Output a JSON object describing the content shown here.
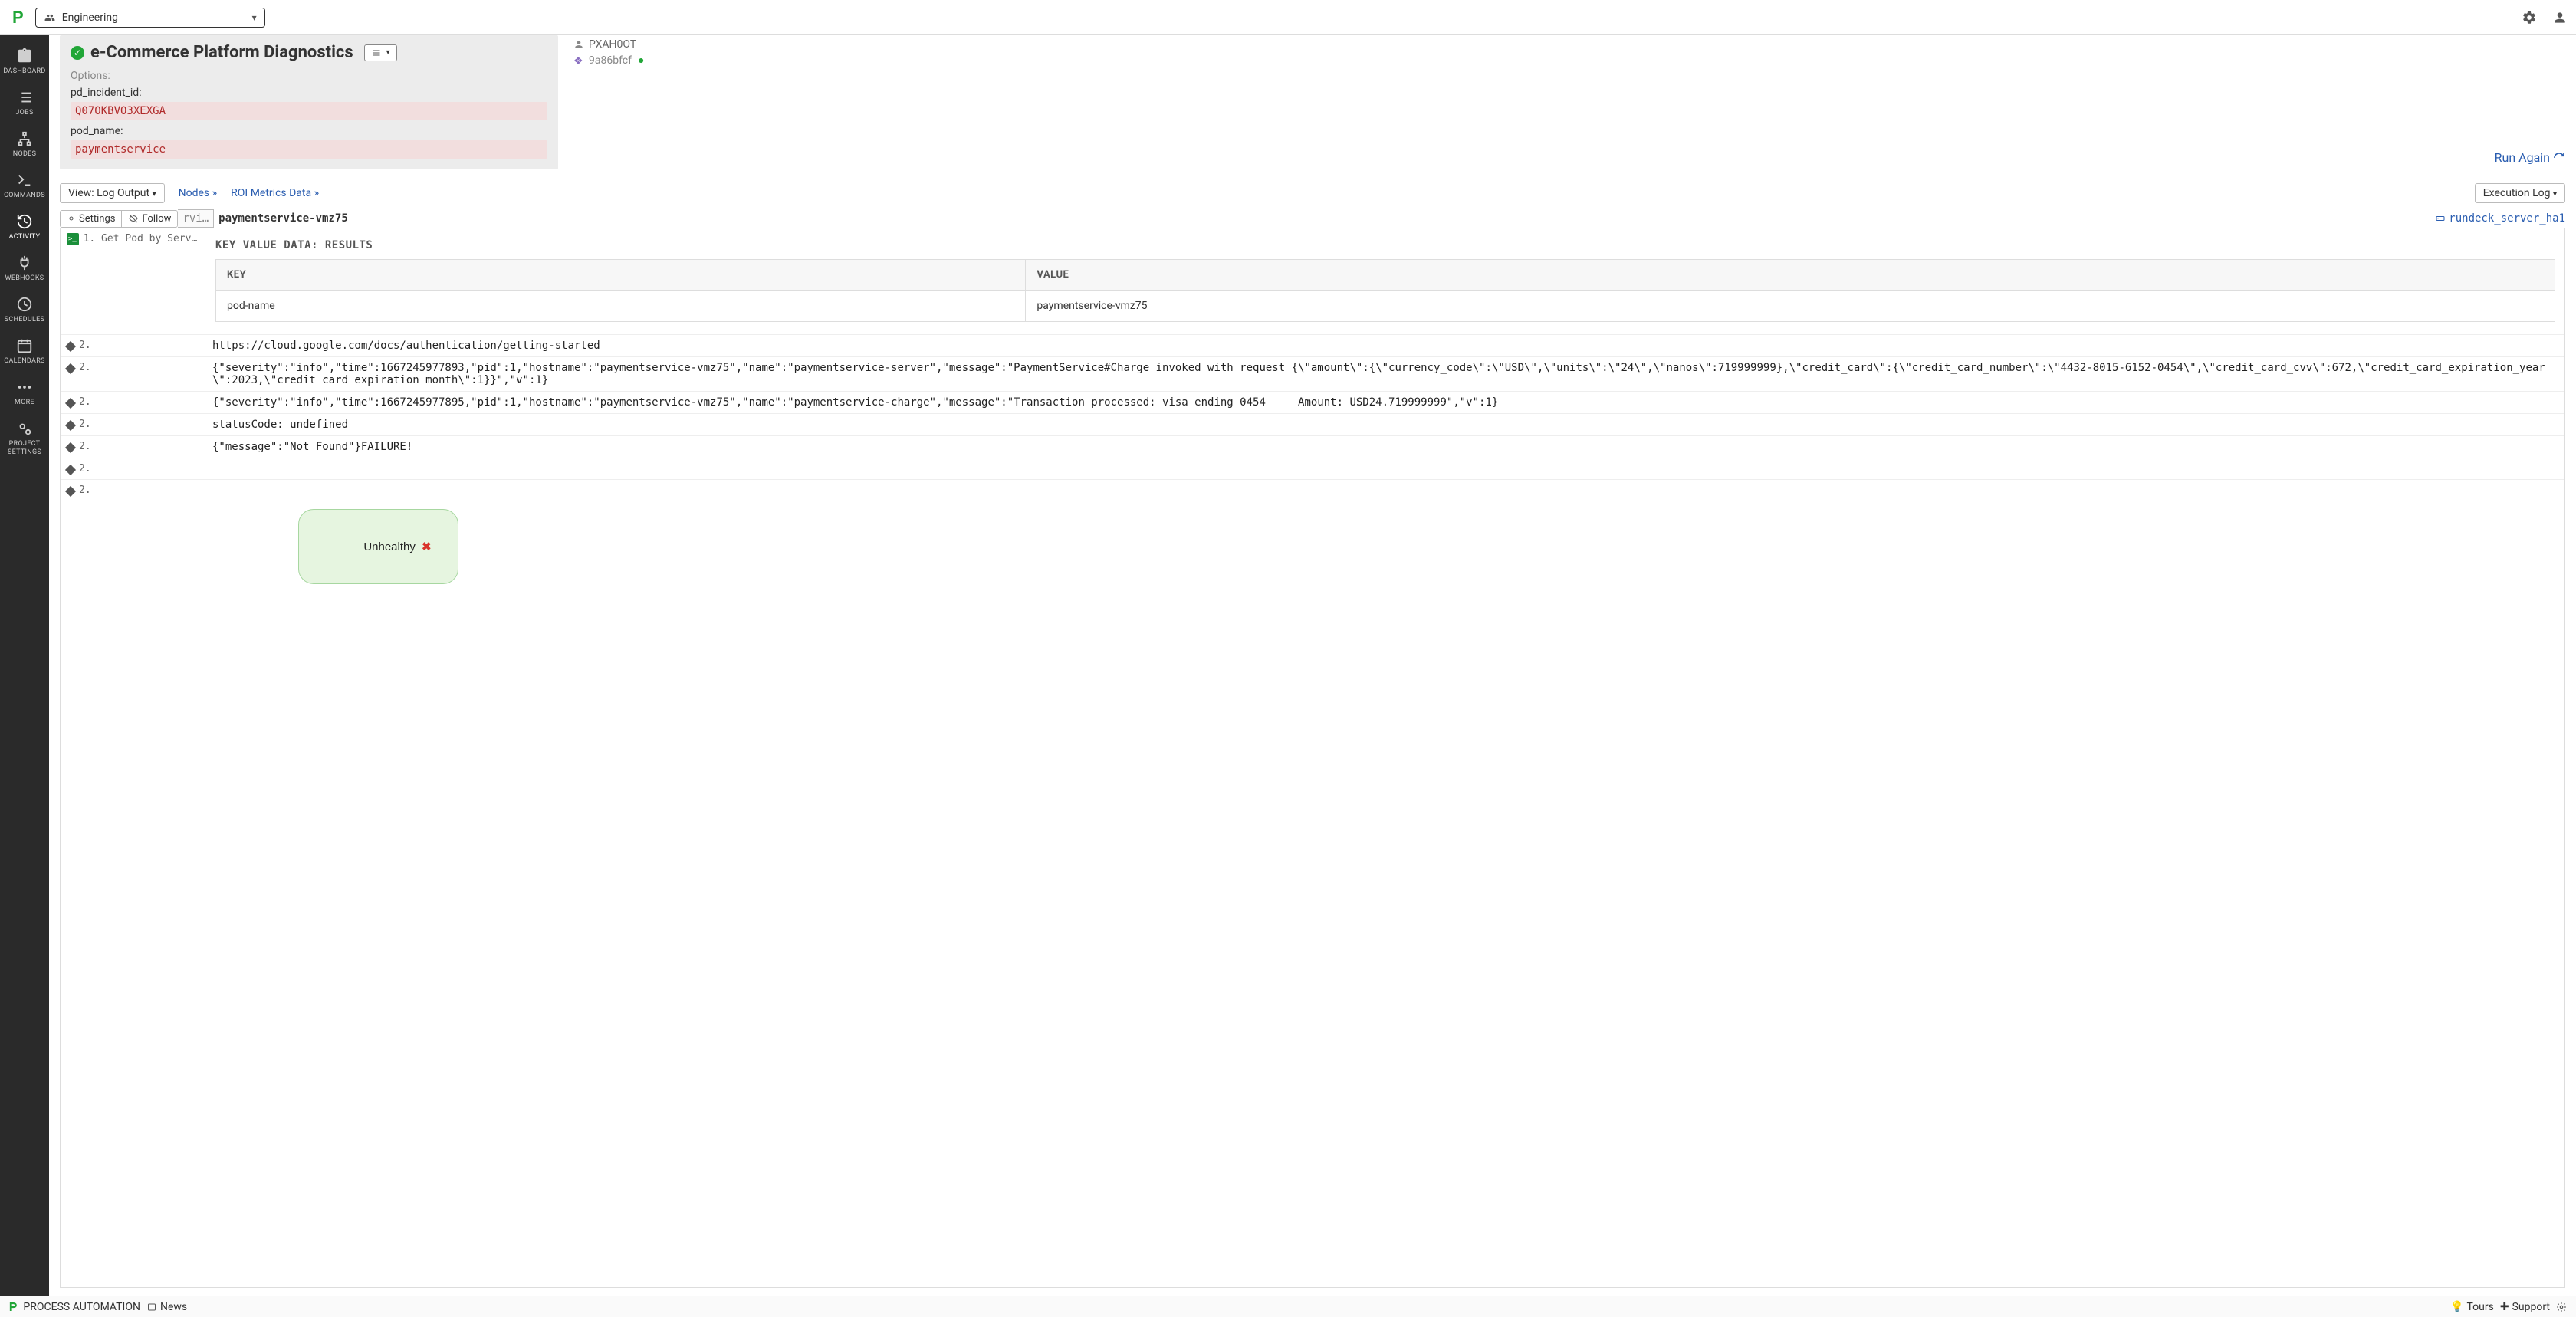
{
  "topbar": {
    "project": "Engineering"
  },
  "sidebar": {
    "items": [
      {
        "label": "DASHBOARD"
      },
      {
        "label": "JOBS"
      },
      {
        "label": "NODES"
      },
      {
        "label": "COMMANDS"
      },
      {
        "label": "ACTIVITY"
      },
      {
        "label": "WEBHOOKS"
      },
      {
        "label": "SCHEDULES"
      },
      {
        "label": "CALENDARS"
      },
      {
        "label": "MORE"
      },
      {
        "label": "PROJECT SETTINGS"
      }
    ]
  },
  "job": {
    "title": "e-Commerce Platform Diagnostics",
    "options_label": "Options:",
    "opts": {
      "pd_incident_id_key": "pd_incident_id:",
      "pd_incident_id_val": "Q07OKBVO3XEXGA",
      "pod_name_key": "pod_name:",
      "pod_name_val": "paymentservice"
    }
  },
  "meta": {
    "user": "PXAH0OT",
    "commit": "9a86bfcf"
  },
  "run_again": "Run Again ",
  "controls": {
    "view_btn": "View: Log Output",
    "nodes": "Nodes »",
    "roi": "ROI Metrics Data »",
    "exec_log": "Execution Log"
  },
  "toolbar": {
    "settings": "Settings",
    "follow": "Follow",
    "rvi": "rvi…",
    "node": "paymentservice-vmz75",
    "server": "rundeck_server_ha1"
  },
  "kv": {
    "header": "KEY VALUE DATA: RESULTS",
    "key_h": "KEY",
    "val_h": "VALUE",
    "row_key": "pod-name",
    "row_val": "paymentservice-vmz75"
  },
  "steps": {
    "one": "1. Get Pod by Servi…",
    "two": "2."
  },
  "log": {
    "l1": "https://cloud.google.com/docs/authentication/getting-started",
    "l2": "{\"severity\":\"info\",\"time\":1667245977893,\"pid\":1,\"hostname\":\"paymentservice-vmz75\",\"name\":\"paymentservice-server\",\"message\":\"PaymentService#Charge invoked with request {\\\"amount\\\":{\\\"currency_code\\\":\\\"USD\\\",\\\"units\\\":\\\"24\\\",\\\"nanos\\\":719999999},\\\"credit_card\\\":{\\\"credit_card_number\\\":\\\"4432-8015-6152-0454\\\",\\\"credit_card_cvv\\\":672,\\\"credit_card_expiration_year\\\":2023,\\\"credit_card_expiration_month\\\":1}}\",\"v\":1}",
    "l3": "{\"severity\":\"info\",\"time\":1667245977895,\"pid\":1,\"hostname\":\"paymentservice-vmz75\",\"name\":\"paymentservice-charge\",\"message\":\"Transaction processed: visa ending 0454     Amount: USD24.719999999\",\"v\":1}",
    "l4": "statusCode: undefined",
    "l5": "{\"message\":\"Not Found\"}FAILURE!"
  },
  "status": {
    "label": "Unhealthy"
  },
  "footer": {
    "brand": "PROCESS AUTOMATION",
    "news": "News",
    "tours": "Tours",
    "support": "Support"
  }
}
